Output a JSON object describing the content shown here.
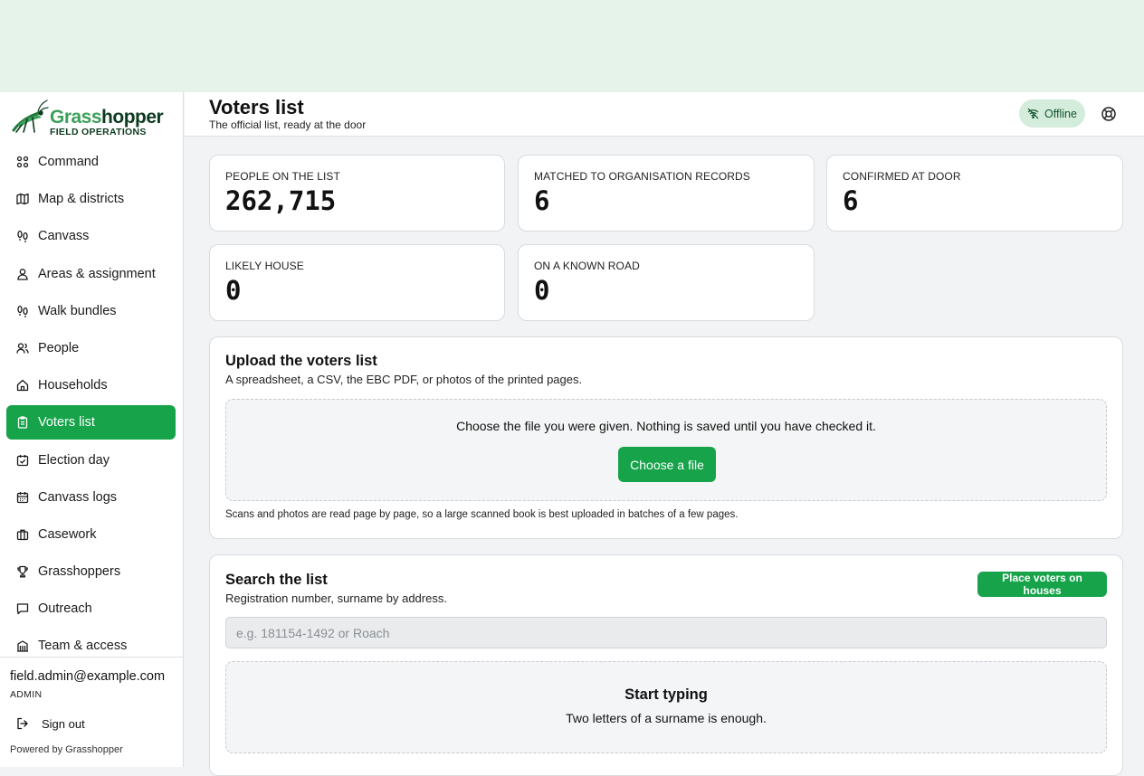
{
  "brand": {
    "name_part1": "Grass",
    "name_part2": "hopper",
    "tagline": "FIELD OPERATIONS",
    "accent": "#16a34a"
  },
  "sidebar": {
    "items": [
      {
        "label": "Command",
        "icon": "command-icon"
      },
      {
        "label": "Map & districts",
        "icon": "map-icon"
      },
      {
        "label": "Canvass",
        "icon": "footprints-icon"
      },
      {
        "label": "Areas & assignment",
        "icon": "user-pin-icon"
      },
      {
        "label": "Walk bundles",
        "icon": "footprints-icon"
      },
      {
        "label": "People",
        "icon": "users-icon"
      },
      {
        "label": "Households",
        "icon": "home-icon"
      },
      {
        "label": "Voters list",
        "icon": "clipboard-icon",
        "active": true
      },
      {
        "label": "Election day",
        "icon": "calendar-check-icon"
      },
      {
        "label": "Canvass logs",
        "icon": "calendar-icon"
      },
      {
        "label": "Casework",
        "icon": "briefcase-icon"
      },
      {
        "label": "Grasshoppers",
        "icon": "trophy-icon"
      },
      {
        "label": "Outreach",
        "icon": "message-icon"
      },
      {
        "label": "Team & access",
        "icon": "building-icon"
      }
    ],
    "user": {
      "email": "field.admin@example.com",
      "role": "ADMIN"
    },
    "sign_out_label": "Sign out",
    "powered_by": "Powered by Grasshopper"
  },
  "header": {
    "title": "Voters list",
    "subtitle": "The official list, ready at the door",
    "status_label": "Offline"
  },
  "stats": [
    {
      "label": "PEOPLE ON THE LIST",
      "value": "262,715"
    },
    {
      "label": "MATCHED TO ORGANISATION RECORDS",
      "value": "6"
    },
    {
      "label": "CONFIRMED AT DOOR",
      "value": "6"
    },
    {
      "label": "LIKELY HOUSE",
      "value": "0"
    },
    {
      "label": "ON A KNOWN ROAD",
      "value": "0"
    }
  ],
  "upload": {
    "title": "Upload the voters list",
    "subtitle": "A spreadsheet, a CSV, the EBC PDF, or photos of the printed pages.",
    "dropzone_text": "Choose the file you were given. Nothing is saved until you have checked it.",
    "button_label": "Choose a file",
    "note": "Scans and photos are read page by page, so a large scanned book is best uploaded in batches of a few pages."
  },
  "search": {
    "title": "Search the list",
    "subtitle": "Registration number, surname by address.",
    "action_label": "Place voters on houses",
    "input_value": "",
    "placeholder": "e.g. 181154-1492 or Roach",
    "empty_title": "Start typing",
    "empty_subtitle": "Two letters of a surname is enough."
  }
}
